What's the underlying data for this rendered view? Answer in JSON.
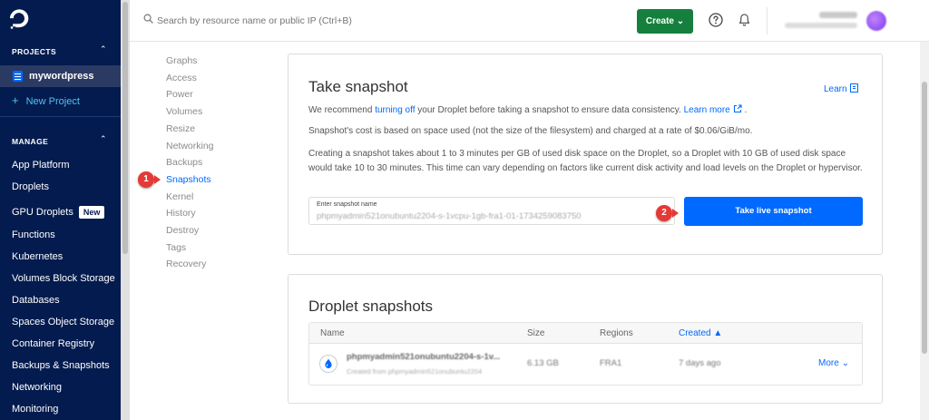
{
  "sidebar": {
    "projects_heading": "PROJECTS",
    "active_project": "mywordpress",
    "new_project": "New Project",
    "manage_heading": "MANAGE",
    "items": [
      {
        "label": "App Platform"
      },
      {
        "label": "Droplets"
      },
      {
        "label": "GPU Droplets",
        "badge": "New"
      },
      {
        "label": "Functions"
      },
      {
        "label": "Kubernetes"
      },
      {
        "label": "Volumes Block Storage"
      },
      {
        "label": "Databases"
      },
      {
        "label": "Spaces Object Storage"
      },
      {
        "label": "Container Registry"
      },
      {
        "label": "Backups & Snapshots"
      },
      {
        "label": "Networking"
      },
      {
        "label": "Monitoring"
      }
    ]
  },
  "topbar": {
    "search_placeholder": "Search by resource name or public IP (Ctrl+B)",
    "create_label": "Create",
    "account_name": "My Team",
    "account_sub": "DigitalOcean"
  },
  "subnav": {
    "items": [
      "Graphs",
      "Access",
      "Power",
      "Volumes",
      "Resize",
      "Networking",
      "Backups",
      "Snapshots",
      "Kernel",
      "History",
      "Destroy",
      "Tags",
      "Recovery"
    ],
    "active": "Snapshots"
  },
  "markers": {
    "one": "1",
    "two": "2"
  },
  "take_snapshot": {
    "title": "Take snapshot",
    "learn_label": "Learn",
    "p1_before": "We recommend ",
    "p1_link": "turning off",
    "p1_after": " your Droplet before taking a snapshot to ensure data consistency. ",
    "p1_learn_more": "Learn more",
    "p1_end": " .",
    "p2": "Snapshot's cost is based on space used (not the size of the filesystem) and charged at a rate of $0.06/GiB/mo.",
    "p3": "Creating a snapshot takes about 1 to 3 minutes per GB of used disk space on the Droplet, so a Droplet with 10 GB of used disk space would take 10 to 30 minutes. This time can vary depending on factors like current disk activity and load levels on the Droplet or hypervisor.",
    "field_label": "Enter snapshot name",
    "field_value": "phpmyadmin521onubuntu2204-s-1vcpu-1gb-fra1-01-1734259083750",
    "button_label": "Take live snapshot"
  },
  "droplet_snapshots": {
    "title": "Droplet snapshots",
    "columns": {
      "name": "Name",
      "size": "Size",
      "regions": "Regions",
      "created": "Created"
    },
    "rows": [
      {
        "name": "phpmyadmin521onubuntu2204-s-1v...",
        "sub": "Created from phpmyadmin521onubuntu2204",
        "size": "6.13 GB",
        "region": "FRA1",
        "created": "7 days ago",
        "more": "More"
      }
    ]
  }
}
